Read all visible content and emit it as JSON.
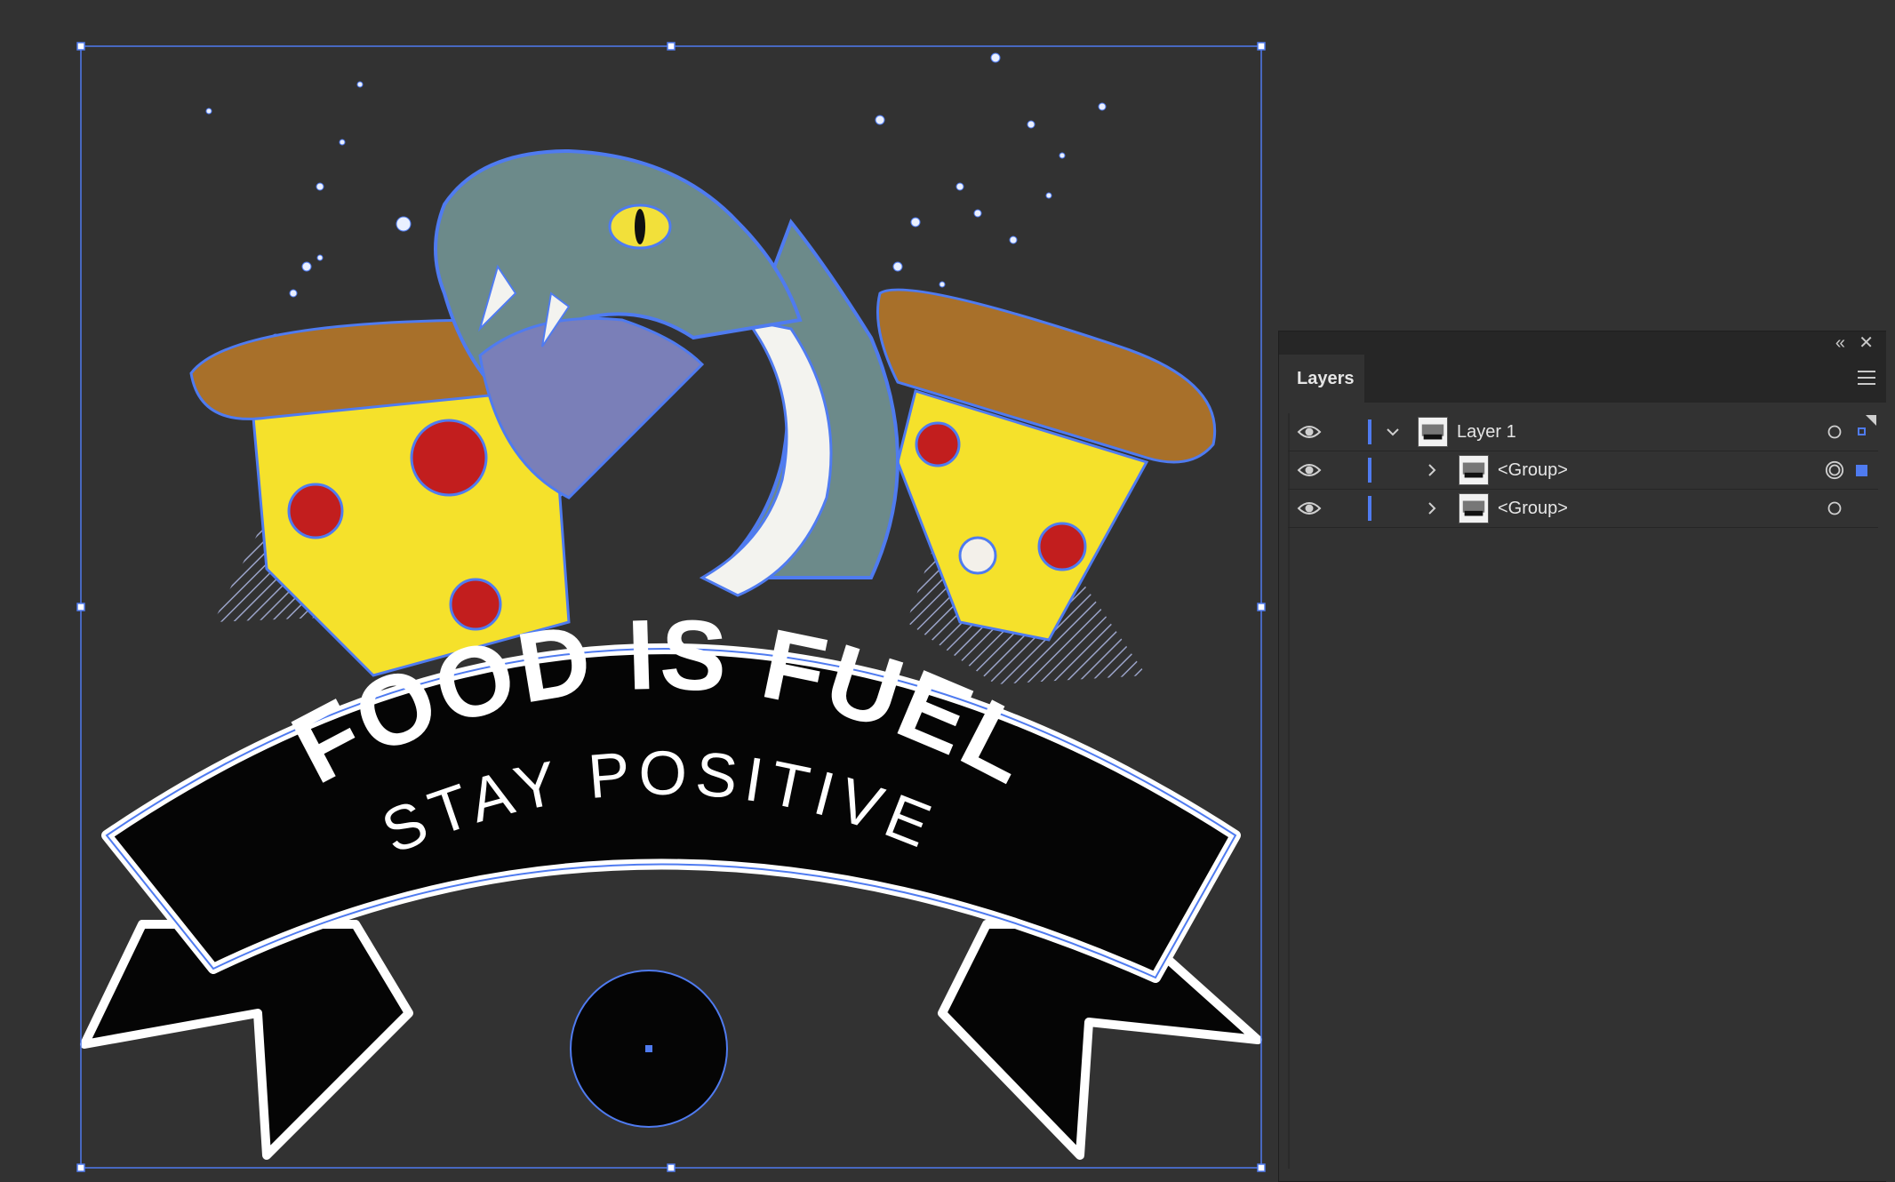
{
  "artwork": {
    "headline": "FOOD IS FUEL",
    "subline": "STAY POSITIVE"
  },
  "colors": {
    "canvas_bg": "#323232",
    "selection": "#4f7bf0",
    "pizza_cheese": "#f5e12b",
    "pizza_crust": "#a8702a",
    "pepperoni": "#c21e1e",
    "snake_body": "#6c8a8a",
    "snake_eye": "#f2e03a",
    "banner_fill": "#050505",
    "banner_outline": "#ffffff"
  },
  "layers_panel": {
    "tab_label": "Layers",
    "collapse_icon": "double-chevron-left-icon",
    "close_icon": "close-icon",
    "menu_icon": "hamburger-menu-icon",
    "rows": [
      {
        "name": "Layer 1",
        "expanded": true,
        "indent": 0,
        "visible": true,
        "targeted": false,
        "selected": true
      },
      {
        "name": "<Group>",
        "expanded": false,
        "indent": 1,
        "visible": true,
        "targeted": true,
        "selected": true
      },
      {
        "name": "<Group>",
        "expanded": false,
        "indent": 1,
        "visible": true,
        "targeted": false,
        "selected": false
      }
    ]
  }
}
